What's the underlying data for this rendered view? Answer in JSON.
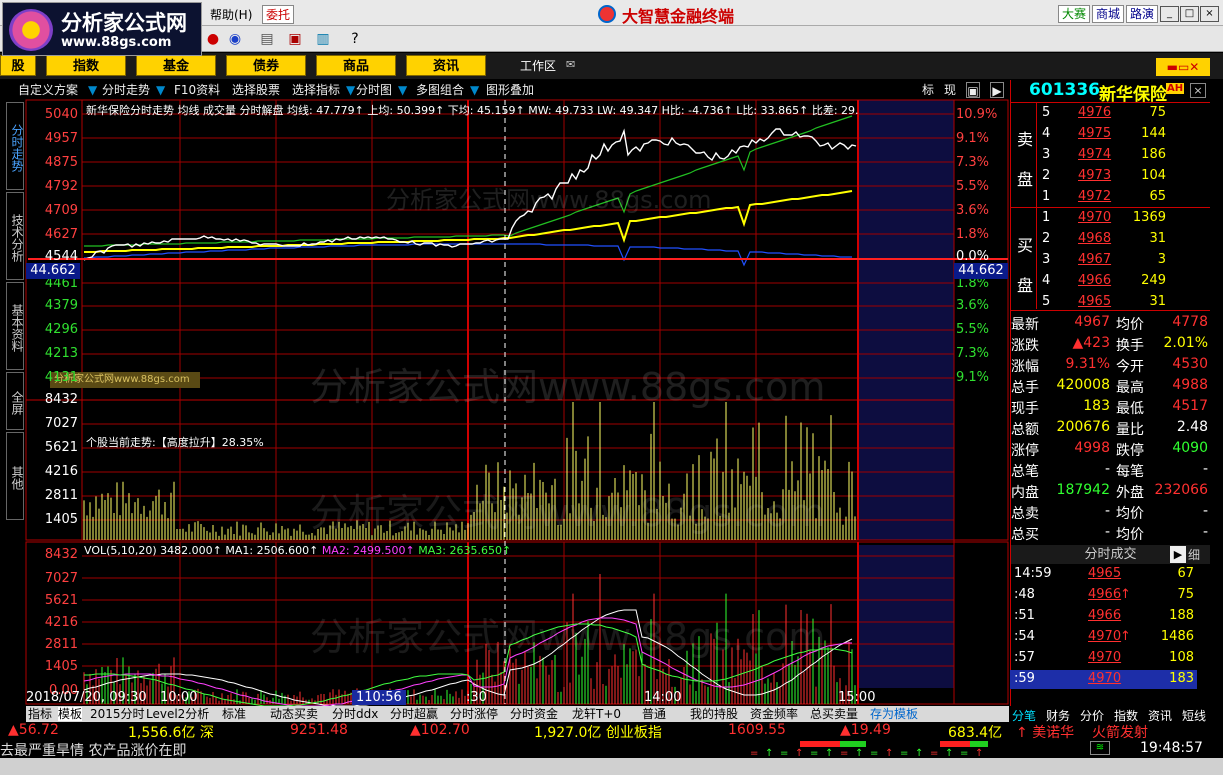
{
  "app": {
    "name": "大智慧金融终端",
    "logo_line1": "分析家公式网",
    "logo_line2": "www.88gs.com"
  },
  "menu": {
    "help": "帮助(H)",
    "entrust": "委托",
    "right_buttons": [
      "大赛",
      "商城",
      "路演"
    ]
  },
  "categories": [
    "股",
    "指数",
    "基金",
    "债券",
    "商品",
    "资讯"
  ],
  "workarea": "工作区",
  "funcbar": [
    "自定义方案",
    "分时走势",
    "F10资料",
    "选择股票",
    "选择指标",
    "分时图",
    "多图组合",
    "图形叠加"
  ],
  "funcbar_right": [
    "标",
    "现"
  ],
  "side_tabs": [
    "分时走势",
    "技术分析",
    "基本资料",
    "全屏",
    "其他"
  ],
  "chart_info": "新华保险分时走势 均线 成交量 分时解盘 均线: 47.779↑ 上均: 50.399↑ 下均: 45.159↑ MW: 49.733 LW: 49.347 H比: -4.736↑ L比: 33.865↑ 比差: 29.",
  "trend_text": "个股当前走势:【高度拉升】28.35%",
  "vol_info": {
    "main": "VOL(5,10,20) 3482.000↑ MA1: 2506.600↑",
    "ma2": "MA2: 2499.500↑",
    "ma3": "MA3: 2635.650↑"
  },
  "watermark": "分析家公式网www.88gs.com",
  "price_axis": [
    "5040",
    "4957",
    "4875",
    "4792",
    "4709",
    "4627",
    "4544",
    "4461",
    "4379",
    "4296",
    "4213",
    "4131"
  ],
  "pct_axis": [
    "10.9%",
    "9.1%",
    "7.3%",
    "5.5%",
    "3.6%",
    "1.8%",
    "0.0%",
    "1.8%",
    "3.6%",
    "5.5%",
    "7.3%",
    "9.1%"
  ],
  "prev_close": "44.662",
  "vol_axis": [
    "8432",
    "7027",
    "5621",
    "4216",
    "2811",
    "1405"
  ],
  "vol_axis2": [
    "8432",
    "7027",
    "5621",
    "4216",
    "2811",
    "1405",
    "0.00"
  ],
  "x_axis": {
    "date": "2018/07/20, 09:30",
    "t1": "10:00",
    "t2": "110:56",
    "t3": ":30",
    "t4": "14:00",
    "t5": "15:00"
  },
  "bottom_tabs": [
    "指标",
    "模板",
    "2015分时",
    "Level2分析",
    "标准",
    "动态买卖",
    "分时ddx",
    "分时超赢",
    "分时涨停",
    "分时资金",
    "龙轩T+0",
    "普通",
    "我的持股",
    "资金频率",
    "总买卖量",
    "存为模板"
  ],
  "ticker": {
    "a": "56.72",
    "b": "1,556.6亿 深",
    "c": "9251.48",
    "d": "102.70",
    "e": "1,927.0亿 创业板指",
    "f": "1609.55",
    "g": "19.49",
    "h": "683.4亿",
    "i": "美诺华",
    "j": "火箭发射"
  },
  "scroll_news": "去最严重旱情 农产品涨价在即",
  "clock": "19:48:57",
  "stock": {
    "code": "601336",
    "name": "新华保险",
    "tag": "AH"
  },
  "order_book": {
    "sell_label": [
      "卖",
      "盘"
    ],
    "buy_label": [
      "买",
      "盘"
    ],
    "sell": [
      {
        "lvl": "5",
        "p": "4976",
        "v": "75"
      },
      {
        "lvl": "4",
        "p": "4975",
        "v": "144"
      },
      {
        "lvl": "3",
        "p": "4974",
        "v": "186"
      },
      {
        "lvl": "2",
        "p": "4973",
        "v": "104"
      },
      {
        "lvl": "1",
        "p": "4972",
        "v": "65"
      }
    ],
    "buy": [
      {
        "lvl": "1",
        "p": "4970",
        "v": "1369"
      },
      {
        "lvl": "2",
        "p": "4968",
        "v": "31"
      },
      {
        "lvl": "3",
        "p": "4967",
        "v": "3"
      },
      {
        "lvl": "4",
        "p": "4966",
        "v": "249"
      },
      {
        "lvl": "5",
        "p": "4965",
        "v": "31"
      }
    ]
  },
  "stats": [
    {
      "k1": "最新",
      "v1": "4967",
      "k2": "均价",
      "v2": "4778"
    },
    {
      "k1": "涨跌",
      "v1": "▲423",
      "k2": "换手",
      "v2": "2.01%"
    },
    {
      "k1": "涨幅",
      "v1": "9.31%",
      "k2": "今开",
      "v2": "4530"
    },
    {
      "k1": "总手",
      "v1": "420008",
      "k2": "最高",
      "v2": "4988"
    },
    {
      "k1": "现手",
      "v1": "183",
      "k2": "最低",
      "v2": "4517"
    },
    {
      "k1": "总额",
      "v1": "200676",
      "k2": "量比",
      "v2": "2.48"
    },
    {
      "k1": "涨停",
      "v1": "4998",
      "k2": "跌停",
      "v2": "4090"
    },
    {
      "k1": "总笔",
      "v1": "-",
      "k2": "每笔",
      "v2": "-"
    },
    {
      "k1": "内盘",
      "v1": "187942",
      "k2": "外盘",
      "v2": "232066"
    },
    {
      "k1": "总卖",
      "v1": "-",
      "k2": "均价",
      "v2": "-"
    },
    {
      "k1": "总买",
      "v1": "-",
      "k2": "均价",
      "v2": "-"
    }
  ],
  "ticks_header": "分时成交",
  "ticks_detail": "细",
  "ticks": [
    {
      "t": "14:59",
      "p": "4965",
      "v": "67",
      "up": ""
    },
    {
      "t": ":48",
      "p": "4966",
      "v": "75",
      "up": "↑"
    },
    {
      "t": ":51",
      "p": "4966",
      "v": "188",
      "up": ""
    },
    {
      "t": ":54",
      "p": "4970",
      "v": "1486",
      "up": "↑"
    },
    {
      "t": ":57",
      "p": "4970",
      "v": "108",
      "up": ""
    },
    {
      "t": ":59",
      "p": "4970",
      "v": "183",
      "up": ""
    }
  ],
  "right_tabs": [
    "分笔",
    "财务",
    "分价",
    "指数",
    "资讯",
    "短线"
  ],
  "colors": {
    "up": "#ff3030",
    "price_line": "#ffffff",
    "avg_line": "#ffff00",
    "grid": "#a00000",
    "accent": "#00ffff"
  }
}
